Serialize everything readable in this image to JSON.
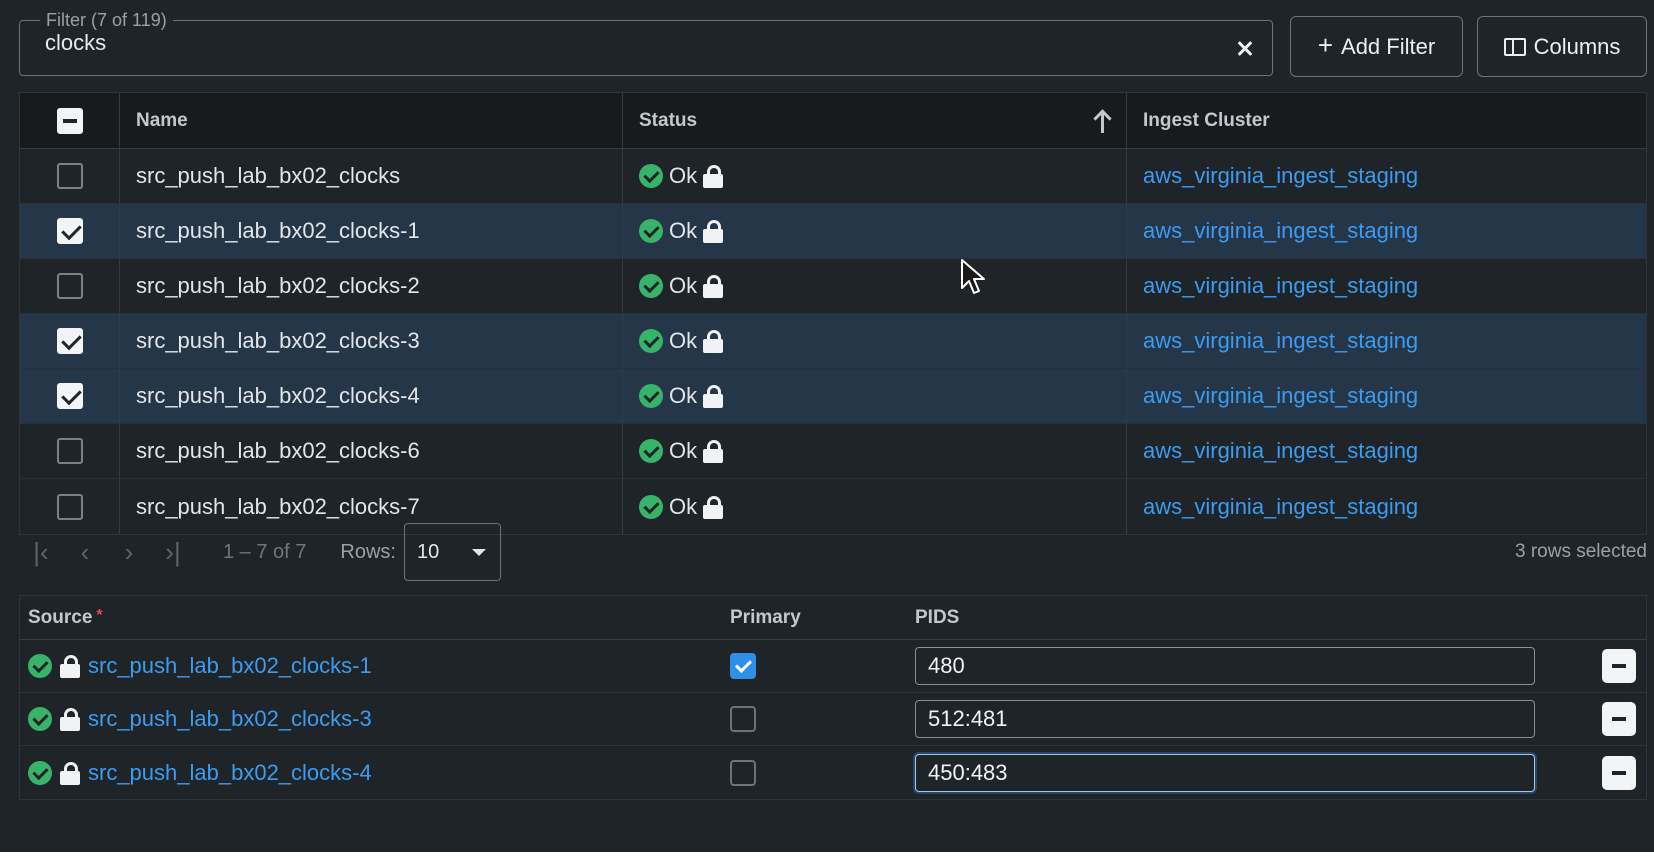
{
  "filter": {
    "legend": "Filter (7 of 119)",
    "value": "clocks"
  },
  "toolbar": {
    "add_filter_label": "Add Filter",
    "columns_label": "Columns"
  },
  "table": {
    "headers": {
      "name": "Name",
      "status": "Status",
      "cluster": "Ingest Cluster"
    },
    "rows": [
      {
        "name": "src_push_lab_bx02_clocks",
        "status": "Ok",
        "cluster": "aws_virginia_ingest_staging",
        "selected": false
      },
      {
        "name": "src_push_lab_bx02_clocks-1",
        "status": "Ok",
        "cluster": "aws_virginia_ingest_staging",
        "selected": true
      },
      {
        "name": "src_push_lab_bx02_clocks-2",
        "status": "Ok",
        "cluster": "aws_virginia_ingest_staging",
        "selected": false
      },
      {
        "name": "src_push_lab_bx02_clocks-3",
        "status": "Ok",
        "cluster": "aws_virginia_ingest_staging",
        "selected": true
      },
      {
        "name": "src_push_lab_bx02_clocks-4",
        "status": "Ok",
        "cluster": "aws_virginia_ingest_staging",
        "selected": true
      },
      {
        "name": "src_push_lab_bx02_clocks-6",
        "status": "Ok",
        "cluster": "aws_virginia_ingest_staging",
        "selected": false
      },
      {
        "name": "src_push_lab_bx02_clocks-7",
        "status": "Ok",
        "cluster": "aws_virginia_ingest_staging",
        "selected": false
      }
    ]
  },
  "pagination": {
    "range": "1 – 7 of 7",
    "rows_label": "Rows:",
    "rows_value": "10",
    "selected_count": "3 rows selected"
  },
  "sources": {
    "headers": {
      "source": "Source",
      "required_mark": "*",
      "primary": "Primary",
      "pids": "PIDS"
    },
    "rows": [
      {
        "name": "src_push_lab_bx02_clocks-1",
        "primary": true,
        "pids": "480"
      },
      {
        "name": "src_push_lab_bx02_clocks-3",
        "primary": false,
        "pids": "512:481"
      },
      {
        "name": "src_push_lab_bx02_clocks-4",
        "primary": false,
        "pids": "450:483"
      }
    ]
  },
  "icons": {
    "status_ok": "check-circle-icon",
    "locked": "lock-icon",
    "sort": "arrow-up-icon",
    "clear": "close-icon",
    "add": "plus-icon",
    "columns": "columns-icon",
    "remove": "minus-icon"
  },
  "colors": {
    "background": "#1f2428",
    "selected_row": "#243647",
    "link": "#3d9bf0",
    "ok_green": "#38b36a",
    "primary_check": "#2f8fe8",
    "required": "#e5484d"
  }
}
